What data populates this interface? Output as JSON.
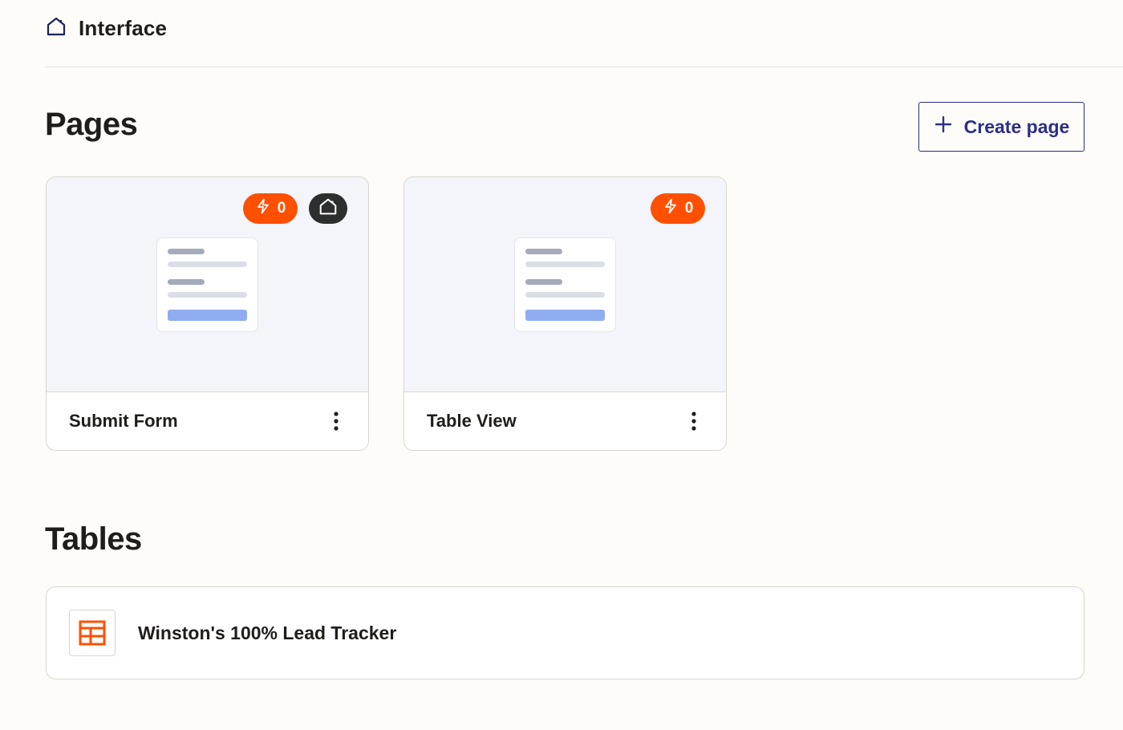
{
  "header": {
    "breadcrumb_icon": "home-icon",
    "breadcrumb_label": "Interface"
  },
  "pages_section": {
    "title": "Pages",
    "create_button_label": "Create page",
    "create_button_icon": "plus-icon",
    "cards": [
      {
        "title": "Submit Form",
        "zap_count": "0",
        "is_home": true
      },
      {
        "title": "Table View",
        "zap_count": "0",
        "is_home": false
      }
    ]
  },
  "tables_section": {
    "title": "Tables",
    "items": [
      {
        "name": "Winston's 100% Lead Tracker",
        "icon": "table-icon"
      }
    ]
  },
  "colors": {
    "accent_orange": "#ff4f00",
    "button_navy": "#2b2f87",
    "home_badge": "#2d2e2e",
    "page_background": "#fdfcf9"
  }
}
